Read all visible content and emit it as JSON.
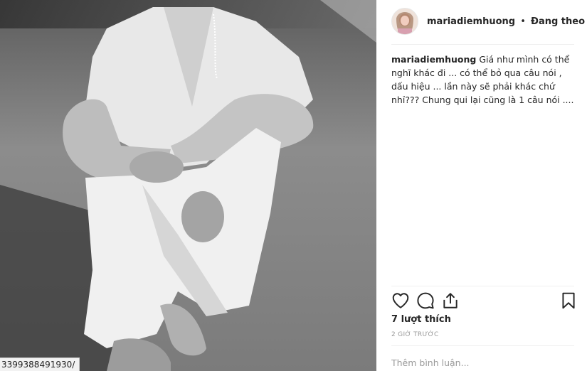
{
  "post_image": {
    "alt": "",
    "status_url": "3399388491930/"
  },
  "header": {
    "username": "mariadiemhuong",
    "separator": "•",
    "follow_status": "Đang theo dõi"
  },
  "caption": {
    "username": "mariadiemhuong",
    "text": "Giá như mình có thể nghĩ khác đi ... có thể bỏ qua câu nói , dấu hiệu ... lần này sẽ phải khác chứ nhỉ??? Chung qui lại cũng là 1 câu nói ...."
  },
  "actions": {
    "icons": [
      "heart-icon",
      "comment-icon",
      "share-icon",
      "bookmark-icon"
    ]
  },
  "likes": "7 lượt thích",
  "time": "2 GIỜ TRƯỚC",
  "comment": {
    "placeholder": "Thêm bình luận...",
    "value": ""
  }
}
